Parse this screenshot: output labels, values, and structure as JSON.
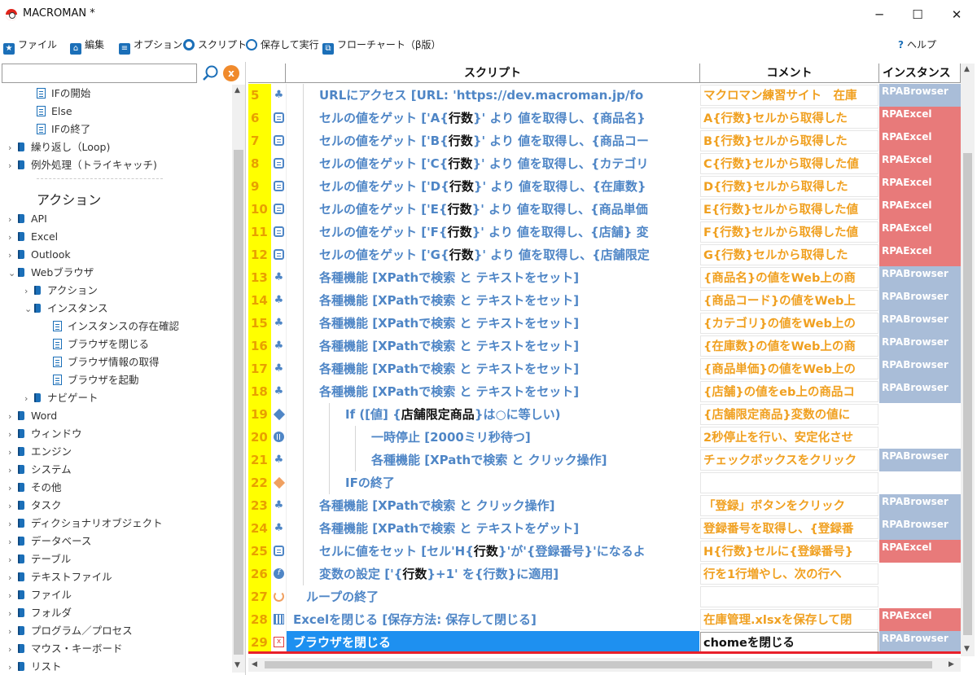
{
  "window": {
    "title": "MACROMAN *",
    "minimize": "─",
    "maximize": "☐",
    "close": "✕"
  },
  "toolbar": {
    "file": "ファイル",
    "edit": "編集",
    "options": "オプション",
    "script": "スクリプト",
    "save_run": "保存して実行",
    "flowchart": "フローチャート（β版）",
    "help": "ヘルプ"
  },
  "tree": {
    "if_start": "IFの開始",
    "else": "Else",
    "if_end": "IFの終了",
    "loop": "繰り返し（Loop)",
    "exception": "例外処理（トライキャッチ)",
    "actions_header": "アクション",
    "api": "API",
    "excel": "Excel",
    "outlook": "Outlook",
    "web_browser": "Webブラウザ",
    "wb_action": "アクション",
    "wb_instance": "インスタンス",
    "inst_exists": "インスタンスの存在確認",
    "browser_close": "ブラウザを閉じる",
    "browser_info": "ブラウザ情報の取得",
    "browser_start": "ブラウザを起動",
    "navigate": "ナビゲート",
    "word": "Word",
    "window": "ウィンドウ",
    "engine": "エンジン",
    "system": "システム",
    "other": "その他",
    "task": "タスク",
    "dict": "ディクショナリオブジェクト",
    "database": "データベース",
    "table": "テーブル",
    "textfile": "テキストファイル",
    "file": "ファイル",
    "folder": "フォルダ",
    "program": "プログラム／プロセス",
    "mouse": "マウス・キーボード",
    "list": "リスト"
  },
  "grid": {
    "header_script": "スクリプト",
    "header_comment": "コメント",
    "header_instance": "インスタンス",
    "rows": [
      {
        "num": "5",
        "icon": "run-icon",
        "indent": 1,
        "pre": "URLにアクセス [URL: 'https://dev.macroman.jp/fo",
        "key": "",
        "post": "",
        "comment": "マクロマン練習サイト　在庫",
        "instance": "RPABrowser",
        "itype": "browser"
      },
      {
        "num": "6",
        "icon": "doc-icon",
        "indent": 1,
        "pre": "セルの値をゲット ['A{",
        "key": "行数",
        "post": "}' より 値を取得し、{商品名}",
        "comment": "A{行数}セルから取得した",
        "instance": "RPAExcel",
        "itype": "excel"
      },
      {
        "num": "7",
        "icon": "doc-icon",
        "indent": 1,
        "pre": "セルの値をゲット ['B{",
        "key": "行数",
        "post": "}' より 値を取得し、{商品コー",
        "comment": "B{行数}セルから取得した",
        "instance": "RPAExcel",
        "itype": "excel"
      },
      {
        "num": "8",
        "icon": "doc-icon",
        "indent": 1,
        "pre": "セルの値をゲット ['C{",
        "key": "行数",
        "post": "}' より 値を取得し、{カテゴリ",
        "comment": "C{行数}セルから取得した値",
        "instance": "RPAExcel",
        "itype": "excel"
      },
      {
        "num": "9",
        "icon": "doc-icon",
        "indent": 1,
        "pre": "セルの値をゲット ['D{",
        "key": "行数",
        "post": "}' より 値を取得し、{在庫数}",
        "comment": "D{行数}セルから取得した",
        "instance": "RPAExcel",
        "itype": "excel"
      },
      {
        "num": "10",
        "icon": "doc-icon",
        "indent": 1,
        "pre": "セルの値をゲット ['E{",
        "key": "行数",
        "post": "}' より 値を取得し、{商品単価",
        "comment": "E{行数}セルから取得した値",
        "instance": "RPAExcel",
        "itype": "excel"
      },
      {
        "num": "11",
        "icon": "doc-icon",
        "indent": 1,
        "pre": "セルの値をゲット ['F{",
        "key": "行数",
        "post": "}' より 値を取得し、{店舗} 変",
        "comment": "F{行数}セルから取得した値",
        "instance": "RPAExcel",
        "itype": "excel"
      },
      {
        "num": "12",
        "icon": "doc-icon",
        "indent": 1,
        "pre": "セルの値をゲット ['G{",
        "key": "行数",
        "post": "}' より 値を取得し、{店舗限定",
        "comment": "G{行数}セルから取得した",
        "instance": "RPAExcel",
        "itype": "excel"
      },
      {
        "num": "13",
        "icon": "run-icon",
        "indent": 1,
        "pre": "各種機能 [XPathで検索 と テキストをセット]",
        "key": "",
        "post": "",
        "comment": "{商品名}の値をWeb上の商",
        "instance": "RPABrowser",
        "itype": "browser"
      },
      {
        "num": "14",
        "icon": "run-icon",
        "indent": 1,
        "pre": "各種機能 [XPathで検索 と テキストをセット]",
        "key": "",
        "post": "",
        "comment": "{商品コード}の値をWeb上",
        "instance": "RPABrowser",
        "itype": "browser"
      },
      {
        "num": "15",
        "icon": "run-icon",
        "indent": 1,
        "pre": "各種機能 [XPathで検索 と テキストをセット]",
        "key": "",
        "post": "",
        "comment": "{カテゴリ}の値をWeb上の",
        "instance": "RPABrowser",
        "itype": "browser"
      },
      {
        "num": "16",
        "icon": "run-icon",
        "indent": 1,
        "pre": "各種機能 [XPathで検索 と テキストをセット]",
        "key": "",
        "post": "",
        "comment": "{在庫数}の値をWeb上の商",
        "instance": "RPABrowser",
        "itype": "browser"
      },
      {
        "num": "17",
        "icon": "run-icon",
        "indent": 1,
        "pre": "各種機能 [XPathで検索 と テキストをセット]",
        "key": "",
        "post": "",
        "comment": "{商品単価}の値をWeb上の",
        "instance": "RPABrowser",
        "itype": "browser"
      },
      {
        "num": "18",
        "icon": "run-icon",
        "indent": 1,
        "pre": "各種機能 [XPathで検索 と テキストをセット]",
        "key": "",
        "post": "",
        "comment": "{店舗}の値をeb上の商品コ",
        "instance": "RPABrowser",
        "itype": "browser"
      },
      {
        "num": "19",
        "icon": "diamond-icon",
        "indent": 2,
        "pre": "If ([値] {",
        "key": "店舗限定商品",
        "post": "}は○に等しい)",
        "comment": "{店舗限定商品}変数の値に",
        "instance": "",
        "itype": "none"
      },
      {
        "num": "20",
        "icon": "pause-icon",
        "indent": 3,
        "pre": "一時停止 [2000ミリ秒待つ]",
        "key": "",
        "post": "",
        "comment": "2秒停止を行い、安定化させ",
        "instance": "",
        "itype": "none"
      },
      {
        "num": "21",
        "icon": "run-icon",
        "indent": 3,
        "pre": "各種機能 [XPathで検索 と クリック操作]",
        "key": "",
        "post": "",
        "comment": "チェックボックスをクリック",
        "instance": "RPABrowser",
        "itype": "browser"
      },
      {
        "num": "22",
        "icon": "diamond-end-icon",
        "indent": 2,
        "pre": "IFの終了",
        "key": "",
        "post": "",
        "comment": "",
        "instance": "",
        "itype": "none"
      },
      {
        "num": "23",
        "icon": "run-icon",
        "indent": 1,
        "pre": "各種機能 [XPathで検索 と クリック操作]",
        "key": "",
        "post": "",
        "comment": "「登録」ボタンをクリック",
        "instance": "RPABrowser",
        "itype": "browser"
      },
      {
        "num": "24",
        "icon": "run-icon",
        "indent": 1,
        "pre": "各種機能 [XPathで検索 と テキストをゲット]",
        "key": "",
        "post": "",
        "comment": "登録番号を取得し、{登録番",
        "instance": "RPABrowser",
        "itype": "browser"
      },
      {
        "num": "25",
        "icon": "doc-icon",
        "indent": 1,
        "pre": "セルに値をセット [セル'H{",
        "key": "行数",
        "post": "}'が'{登録番号}'になるよ",
        "comment": "H{行数}セルに{登録番号}",
        "instance": "RPAExcel",
        "itype": "excel"
      },
      {
        "num": "26",
        "icon": "var-icon",
        "indent": 1,
        "pre": "変数の設定 ['{",
        "key": "行数",
        "post": "}+1' を{行数}に適用]",
        "comment": "行を1行増やし、次の行へ",
        "instance": "",
        "itype": "none"
      },
      {
        "num": "27",
        "icon": "loop-icon",
        "indent": 0.5,
        "pre": "ループの終了",
        "key": "",
        "post": "",
        "comment": "",
        "instance": "",
        "itype": "none"
      },
      {
        "num": "28",
        "icon": "table-icon",
        "indent": 0,
        "pre": "Excelを閉じる [保存方法: 保存して閉じる]",
        "key": "",
        "post": "",
        "comment": "在庫管理.xlsxを保存して閉",
        "instance": "RPAExcel",
        "itype": "excel"
      },
      {
        "num": "29",
        "icon": "close-window-icon",
        "indent": 0,
        "pre": "ブラウザを閉じる",
        "key": "",
        "post": "",
        "comment": "chomeを閉じる",
        "instance": "RPABrowser",
        "itype": "browser",
        "selected": true
      }
    ]
  }
}
